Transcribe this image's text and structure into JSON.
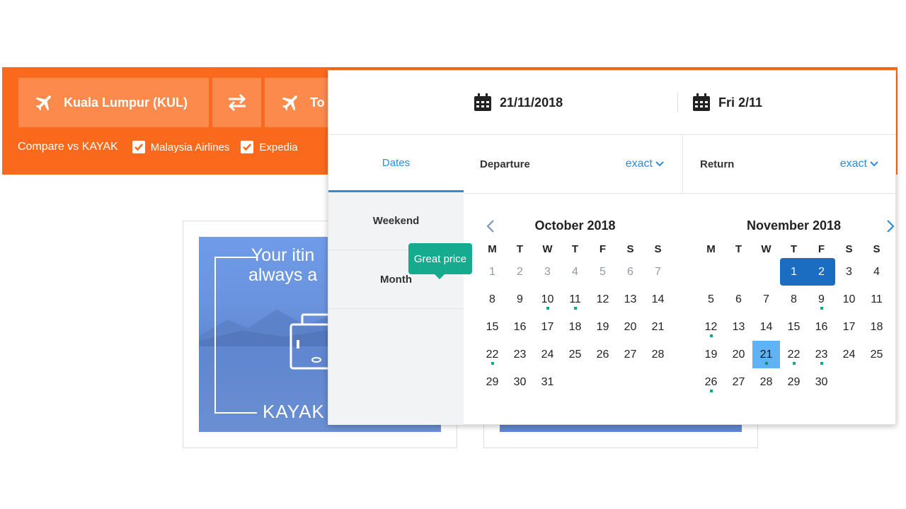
{
  "colors": {
    "brand_orange": "#fb6a1c",
    "accent_blue": "#2a8cde",
    "selected_blue": "#1a6dc1",
    "hover_blue": "#5fb3f4",
    "price_green": "#16ab8f"
  },
  "search": {
    "origin": "Kuala Lumpur (KUL)",
    "destination": "To",
    "swap_icon": "swap-arrows-icon",
    "plane_icon": "plane-icon",
    "compare_label": "Compare vs KAYAK",
    "compare_options": [
      {
        "label": "Malaysia Airlines",
        "checked": true
      },
      {
        "label": "Expedia",
        "checked": true
      }
    ]
  },
  "ad": {
    "headline": "Your itin\nalways a",
    "brand": "KAYAK"
  },
  "picker": {
    "departure_date": "21/11/2018",
    "return_date": "Fri 2/11",
    "calendar_icon": "calendar-icon",
    "tabs": [
      "Dates",
      "Weekend",
      "Month"
    ],
    "departure_label": "Departure",
    "return_label": "Return",
    "departure_mode": "exact",
    "return_mode": "exact",
    "weekdays": [
      "M",
      "T",
      "W",
      "T",
      "F",
      "S",
      "S"
    ],
    "tooltip": "Great price",
    "months": [
      {
        "title": "October 2018",
        "offset": 0,
        "days": 31,
        "muted_until": 8,
        "dots": [
          10,
          11,
          22
        ],
        "selected": [],
        "hover": []
      },
      {
        "title": "November 2018",
        "offset": 3,
        "days": 30,
        "muted_until": 0,
        "dots": [
          9,
          12,
          21,
          22,
          23,
          26
        ],
        "selected": [
          1,
          2
        ],
        "hover": [
          21
        ]
      }
    ]
  }
}
